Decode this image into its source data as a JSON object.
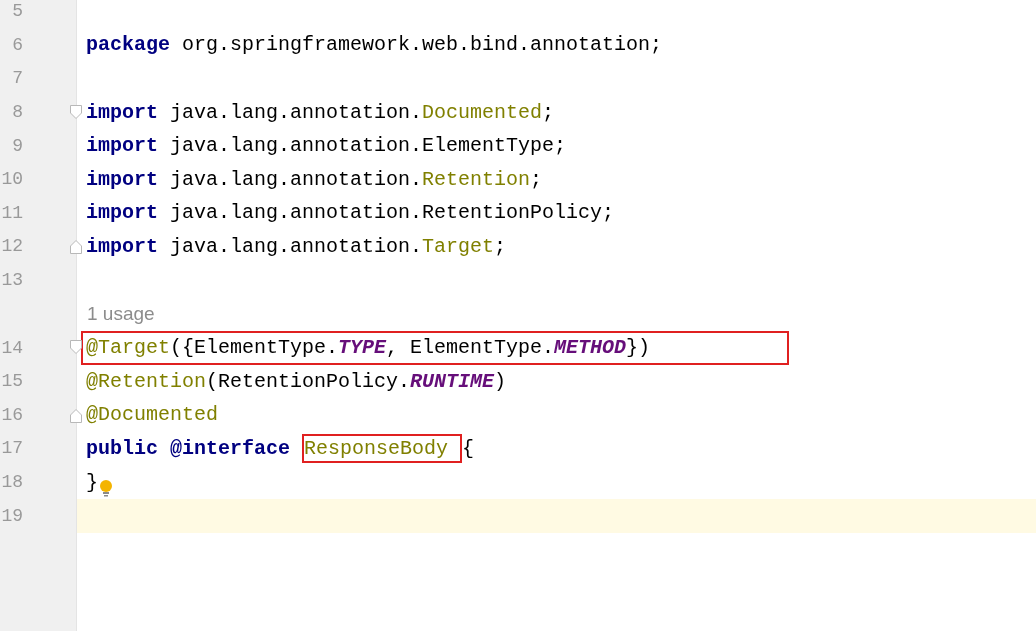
{
  "editor": {
    "lines": [
      {
        "kind": "code",
        "number": "5"
      },
      {
        "kind": "code",
        "number": "6",
        "tokens": [
          {
            "text": "package",
            "kind": "keyword"
          },
          {
            "text": " org.springframework.web.bind.annotation;",
            "kind": "plain"
          }
        ]
      },
      {
        "kind": "code",
        "number": "7"
      },
      {
        "kind": "code",
        "number": "8",
        "fold_start": true,
        "tokens": [
          {
            "text": "import",
            "kind": "keyword"
          },
          {
            "text": " java.lang.annotation.",
            "kind": "plain"
          },
          {
            "text": "Documented",
            "kind": "annotation"
          },
          {
            "text": ";",
            "kind": "plain"
          }
        ]
      },
      {
        "kind": "code",
        "number": "9",
        "tokens": [
          {
            "text": "import",
            "kind": "keyword"
          },
          {
            "text": " java.lang.annotation.ElementType;",
            "kind": "plain"
          }
        ]
      },
      {
        "kind": "code",
        "number": "10",
        "tokens": [
          {
            "text": "import",
            "kind": "keyword"
          },
          {
            "text": " java.lang.annotation.",
            "kind": "plain"
          },
          {
            "text": "Retention",
            "kind": "annotation"
          },
          {
            "text": ";",
            "kind": "plain"
          }
        ]
      },
      {
        "kind": "code",
        "number": "11",
        "tokens": [
          {
            "text": "import",
            "kind": "keyword"
          },
          {
            "text": " java.lang.annotation.RetentionPolicy;",
            "kind": "plain"
          }
        ]
      },
      {
        "kind": "code",
        "number": "12",
        "fold_end": true,
        "tokens": [
          {
            "text": "import",
            "kind": "keyword"
          },
          {
            "text": " java.lang.annotation.",
            "kind": "plain"
          },
          {
            "text": "Target",
            "kind": "annotation"
          },
          {
            "text": ";",
            "kind": "plain"
          }
        ]
      },
      {
        "kind": "code",
        "number": "13"
      },
      {
        "kind": "hint",
        "text": "1 usage"
      },
      {
        "kind": "code",
        "number": "14",
        "fold_start": true,
        "boxed": true,
        "tokens": [
          {
            "text": "@Target",
            "kind": "annotation"
          },
          {
            "text": "({ElementType.",
            "kind": "plain"
          },
          {
            "text": "TYPE",
            "kind": "constant"
          },
          {
            "text": ", ElementType.",
            "kind": "plain"
          },
          {
            "text": "METHOD",
            "kind": "constant"
          },
          {
            "text": "})",
            "kind": "plain"
          }
        ]
      },
      {
        "kind": "code",
        "number": "15",
        "tokens": [
          {
            "text": "@Retention",
            "kind": "annotation"
          },
          {
            "text": "(RetentionPolicy.",
            "kind": "plain"
          },
          {
            "text": "RUNTIME",
            "kind": "constant"
          },
          {
            "text": ")",
            "kind": "plain"
          }
        ]
      },
      {
        "kind": "code",
        "number": "16",
        "fold_end": true,
        "tokens": [
          {
            "text": "@Documented",
            "kind": "annotation"
          }
        ]
      },
      {
        "kind": "code",
        "number": "17",
        "tokens": [
          {
            "text": "public ",
            "kind": "keyword"
          },
          {
            "text": "@interface ",
            "kind": "keyword"
          },
          {
            "text": "ResponseBody ",
            "kind": "annotation",
            "boxed": true
          },
          {
            "text": "{",
            "kind": "plain"
          }
        ]
      },
      {
        "kind": "code",
        "number": "18",
        "bulb": true,
        "tokens": [
          {
            "text": "}",
            "kind": "plain"
          }
        ]
      },
      {
        "kind": "code",
        "number": "19",
        "current": true
      }
    ]
  }
}
